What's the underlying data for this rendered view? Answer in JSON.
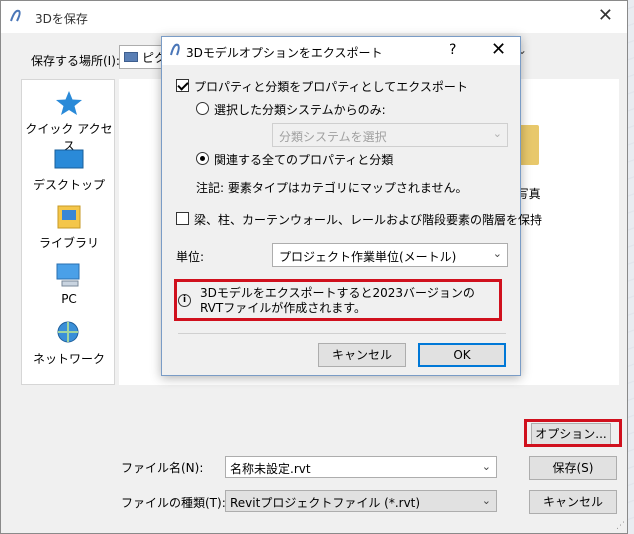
{
  "save_dialog": {
    "title": "3Dを保存",
    "save_location_label": "保存する場所(I):",
    "save_location_value": "ピク",
    "sidebar": [
      {
        "label": "クイック アクセス",
        "icon": "star-icon"
      },
      {
        "label": "デスクトップ",
        "icon": "desktop-icon"
      },
      {
        "label": "ライブラリ",
        "icon": "library-icon"
      },
      {
        "label": "PC",
        "icon": "pc-icon"
      },
      {
        "label": "ネットワーク",
        "icon": "network-icon"
      }
    ],
    "photos_label": ")写真",
    "options_button": "オプション...",
    "filename_label": "ファイル名(N):",
    "filename_value": "名称未設定.rvt",
    "filetype_label": "ファイルの種類(T):",
    "filetype_value": "Revitプロジェクトファイル (*.rvt)",
    "save_button": "保存(S)",
    "cancel_button": "キャンセル"
  },
  "options_dialog": {
    "title": "3Dモデルオプションをエクスポート",
    "help": "?",
    "export_props_label": "プロパティと分類をプロパティとしてエクスポート",
    "radio_selected_only": "選択した分類システムからのみ:",
    "classification_placeholder": "分類システムを選択",
    "radio_all_related": "関連する全てのプロパティと分類",
    "note": "注記: 要素タイプはカテゴリにマップされません。",
    "keep_hierarchy_label": "梁、柱、カーテンウォール、レールおよび階段要素の階層を保持",
    "unit_label": "単位:",
    "unit_value": "プロジェクト作業単位(メートル)",
    "info_text": "3Dモデルをエクスポートすると2023バージョンのRVTファイルが作成されます。",
    "cancel_button": "キャンセル",
    "ok_button": "OK"
  },
  "colors": {
    "highlight": "#d0101d",
    "accent": "#0078d7"
  }
}
